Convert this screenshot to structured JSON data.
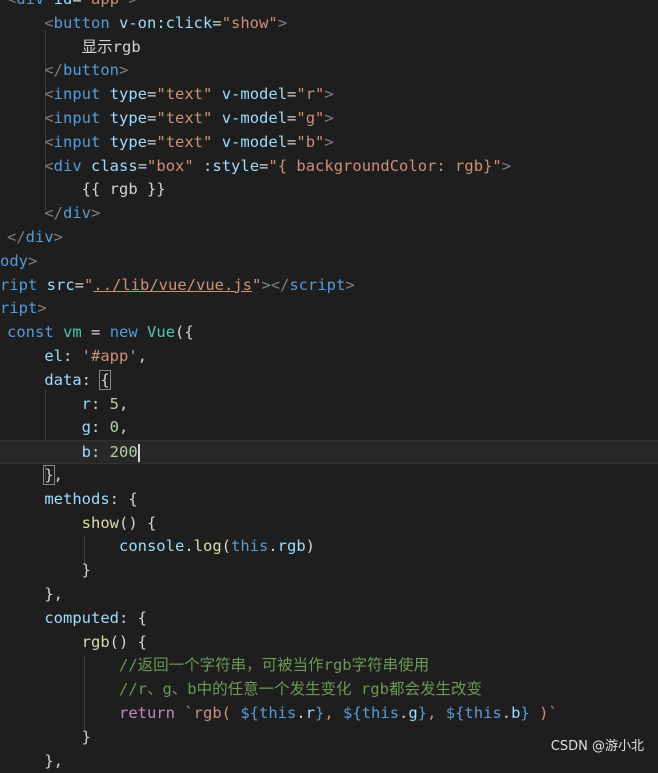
{
  "editor": {
    "lines": [
      [
        [
          "bracket",
          "<"
        ],
        [
          "tag",
          "div"
        ],
        [
          "txt",
          " "
        ],
        [
          "attr",
          "id"
        ],
        [
          "punc",
          "="
        ],
        [
          "str",
          "\"app\""
        ],
        [
          "bracket",
          ">"
        ]
      ],
      [
        [
          "txt",
          "    "
        ],
        [
          "bracket",
          "<"
        ],
        [
          "tag",
          "button"
        ],
        [
          "txt",
          " "
        ],
        [
          "attr",
          "v-on:click"
        ],
        [
          "punc",
          "="
        ],
        [
          "str",
          "\"show\""
        ],
        [
          "bracket",
          ">"
        ]
      ],
      [
        [
          "txt",
          "        显示rgb"
        ]
      ],
      [
        [
          "txt",
          "    "
        ],
        [
          "bracket",
          "</"
        ],
        [
          "tag",
          "button"
        ],
        [
          "bracket",
          ">"
        ]
      ],
      [
        [
          "txt",
          "    "
        ],
        [
          "bracket",
          "<"
        ],
        [
          "tag",
          "input"
        ],
        [
          "txt",
          " "
        ],
        [
          "attr",
          "type"
        ],
        [
          "punc",
          "="
        ],
        [
          "str",
          "\"text\""
        ],
        [
          "txt",
          " "
        ],
        [
          "attr",
          "v-model"
        ],
        [
          "punc",
          "="
        ],
        [
          "str",
          "\"r\""
        ],
        [
          "bracket",
          ">"
        ]
      ],
      [
        [
          "txt",
          "    "
        ],
        [
          "bracket",
          "<"
        ],
        [
          "tag",
          "input"
        ],
        [
          "txt",
          " "
        ],
        [
          "attr",
          "type"
        ],
        [
          "punc",
          "="
        ],
        [
          "str",
          "\"text\""
        ],
        [
          "txt",
          " "
        ],
        [
          "attr",
          "v-model"
        ],
        [
          "punc",
          "="
        ],
        [
          "str",
          "\"g\""
        ],
        [
          "bracket",
          ">"
        ]
      ],
      [
        [
          "txt",
          "    "
        ],
        [
          "bracket",
          "<"
        ],
        [
          "tag",
          "input"
        ],
        [
          "txt",
          " "
        ],
        [
          "attr",
          "type"
        ],
        [
          "punc",
          "="
        ],
        [
          "str",
          "\"text\""
        ],
        [
          "txt",
          " "
        ],
        [
          "attr",
          "v-model"
        ],
        [
          "punc",
          "="
        ],
        [
          "str",
          "\"b\""
        ],
        [
          "bracket",
          ">"
        ]
      ],
      [
        [
          "txt",
          "    "
        ],
        [
          "bracket",
          "<"
        ],
        [
          "tag",
          "div"
        ],
        [
          "txt",
          " "
        ],
        [
          "attr",
          "class"
        ],
        [
          "punc",
          "="
        ],
        [
          "str",
          "\"box\""
        ],
        [
          "txt",
          " "
        ],
        [
          "attr",
          ":style"
        ],
        [
          "punc",
          "="
        ],
        [
          "str",
          "\"{ backgroundColor: rgb}\""
        ],
        [
          "bracket",
          ">"
        ]
      ],
      [
        [
          "txt",
          "        {{ rgb }}"
        ]
      ],
      [
        [
          "txt",
          "    "
        ],
        [
          "bracket",
          "</"
        ],
        [
          "tag",
          "div"
        ],
        [
          "bracket",
          ">"
        ]
      ],
      [
        [
          "bracket",
          "</"
        ],
        [
          "tag",
          "div"
        ],
        [
          "bracket",
          ">"
        ]
      ],
      [
        [
          "tag",
          "ody"
        ],
        [
          "bracket",
          ">"
        ]
      ],
      [
        [
          "tag",
          "ript"
        ],
        [
          "txt",
          " "
        ],
        [
          "attr",
          "src"
        ],
        [
          "punc",
          "="
        ],
        [
          "str",
          "\""
        ],
        [
          "strlink",
          "../lib/vue/vue.js"
        ],
        [
          "str",
          "\""
        ],
        [
          "bracket",
          "></"
        ],
        [
          "tag",
          "script"
        ],
        [
          "bracket",
          ">"
        ]
      ],
      [
        [
          "tag",
          "ript"
        ],
        [
          "bracket",
          ">"
        ]
      ],
      [
        [
          "kw",
          "const"
        ],
        [
          "txt",
          " "
        ],
        [
          "cls",
          "vm"
        ],
        [
          "punc",
          " = "
        ],
        [
          "kw",
          "new"
        ],
        [
          "txt",
          " "
        ],
        [
          "cls",
          "Vue"
        ],
        [
          "punc",
          "({"
        ]
      ],
      [
        [
          "txt",
          "    "
        ],
        [
          "prop",
          "el"
        ],
        [
          "punc",
          ": "
        ],
        [
          "str",
          "'#app'"
        ],
        [
          "punc",
          ","
        ]
      ],
      [
        [
          "txt",
          "    "
        ],
        [
          "prop",
          "data"
        ],
        [
          "punc",
          ": "
        ],
        [
          "matchbr",
          "{"
        ]
      ],
      [
        [
          "txt",
          "        "
        ],
        [
          "prop",
          "r"
        ],
        [
          "punc",
          ": "
        ],
        [
          "num",
          "5"
        ],
        [
          "punc",
          ","
        ]
      ],
      [
        [
          "txt",
          "        "
        ],
        [
          "prop",
          "g"
        ],
        [
          "punc",
          ": "
        ],
        [
          "num",
          "0"
        ],
        [
          "punc",
          ","
        ]
      ],
      [
        [
          "txt",
          "        "
        ],
        [
          "prop",
          "b"
        ],
        [
          "punc",
          ": "
        ],
        [
          "num",
          "200"
        ],
        [
          "cursor",
          ""
        ]
      ],
      [
        [
          "txt",
          "    "
        ],
        [
          "matchbr",
          "}"
        ],
        [
          "punc",
          ","
        ]
      ],
      [
        [
          "txt",
          "    "
        ],
        [
          "prop",
          "methods"
        ],
        [
          "punc",
          ": {"
        ]
      ],
      [
        [
          "txt",
          "        "
        ],
        [
          "fn",
          "show"
        ],
        [
          "punc",
          "() {"
        ]
      ],
      [
        [
          "txt",
          "            "
        ],
        [
          "prop",
          "console"
        ],
        [
          "punc",
          "."
        ],
        [
          "fn",
          "log"
        ],
        [
          "punc",
          "("
        ],
        [
          "kw",
          "this"
        ],
        [
          "punc",
          "."
        ],
        [
          "prop",
          "rgb"
        ],
        [
          "punc",
          ")"
        ]
      ],
      [
        [
          "txt",
          "        "
        ],
        [
          "punc",
          "}"
        ]
      ],
      [
        [
          "txt",
          "    "
        ],
        [
          "punc",
          "},"
        ]
      ],
      [
        [
          "txt",
          "    "
        ],
        [
          "prop",
          "computed"
        ],
        [
          "punc",
          ": {"
        ]
      ],
      [
        [
          "txt",
          "        "
        ],
        [
          "fn",
          "rgb"
        ],
        [
          "punc",
          "() {"
        ]
      ],
      [
        [
          "txt",
          "            "
        ],
        [
          "cmt",
          "//返回一个字符串，可被当作rgb字符串使用"
        ]
      ],
      [
        [
          "txt",
          "            "
        ],
        [
          "cmt",
          "//r、g、b中的任意一个发生变化 rgb都会发生改变"
        ]
      ],
      [
        [
          "txt",
          "            "
        ],
        [
          "ctrl",
          "return"
        ],
        [
          "txt",
          " "
        ],
        [
          "str",
          "`rgb( "
        ],
        [
          "kw",
          "${"
        ],
        [
          "kw",
          "this"
        ],
        [
          "punc",
          "."
        ],
        [
          "prop",
          "r"
        ],
        [
          "kw",
          "}"
        ],
        [
          "str",
          ", "
        ],
        [
          "kw",
          "${"
        ],
        [
          "kw",
          "this"
        ],
        [
          "punc",
          "."
        ],
        [
          "prop",
          "g"
        ],
        [
          "kw",
          "}"
        ],
        [
          "str",
          ", "
        ],
        [
          "kw",
          "${"
        ],
        [
          "kw",
          "this"
        ],
        [
          "punc",
          "."
        ],
        [
          "prop",
          "b"
        ],
        [
          "kw",
          "}"
        ],
        [
          "str",
          " )`"
        ]
      ],
      [
        [
          "txt",
          "        "
        ],
        [
          "punc",
          "}"
        ]
      ],
      [
        [
          "txt",
          "    "
        ],
        [
          "punc",
          "},"
        ]
      ]
    ]
  },
  "watermark": "CSDN @游小北"
}
